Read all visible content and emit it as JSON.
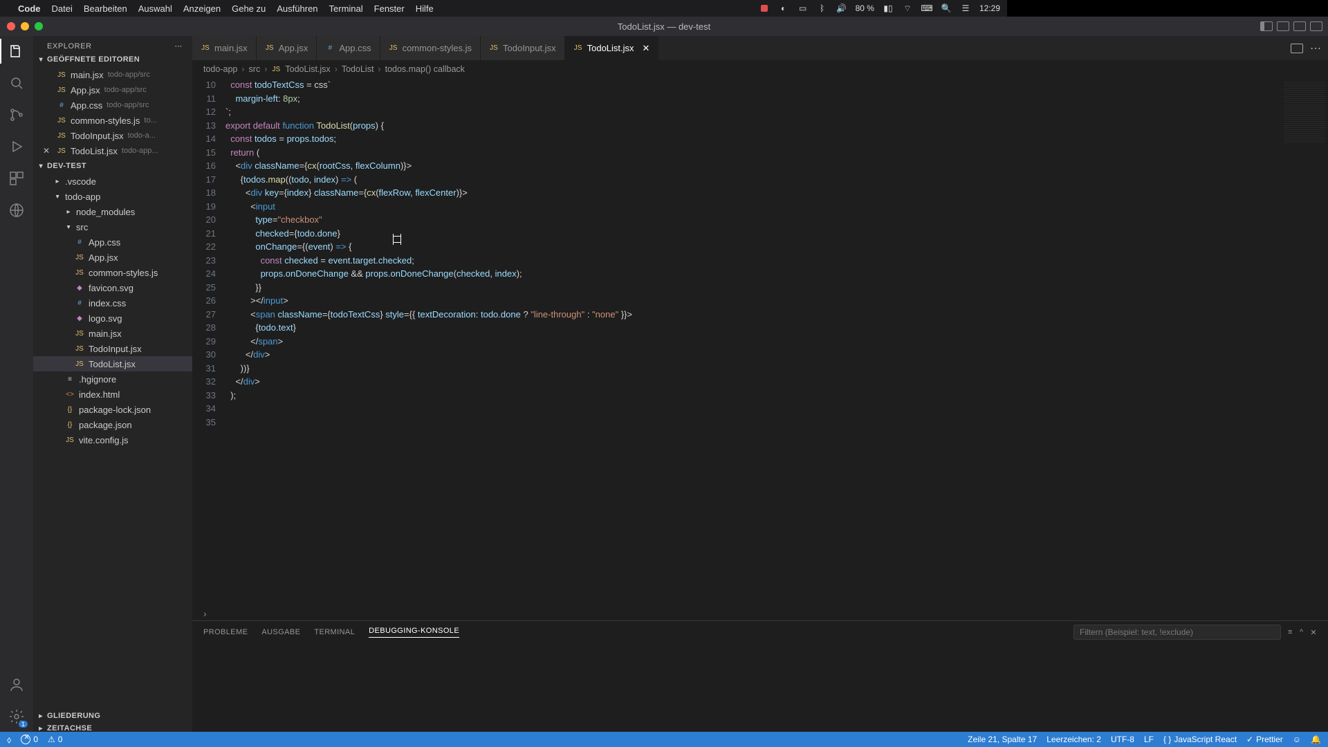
{
  "menubar": {
    "app": "Code",
    "items": [
      "Datei",
      "Bearbeiten",
      "Auswahl",
      "Anzeigen",
      "Gehe zu",
      "Ausführen",
      "Terminal",
      "Fenster",
      "Hilfe"
    ],
    "battery": "80 %",
    "time": "12:29"
  },
  "window": {
    "title": "TodoList.jsx — dev-test"
  },
  "sidebar": {
    "title": "EXPLORER",
    "openEditorsLabel": "GEÖFFNETE EDITOREN",
    "openEditors": [
      {
        "name": "main.jsx",
        "path": "todo-app/src"
      },
      {
        "name": "App.jsx",
        "path": "todo-app/src"
      },
      {
        "name": "App.css",
        "path": "todo-app/src"
      },
      {
        "name": "common-styles.js",
        "path": "to..."
      },
      {
        "name": "TodoInput.jsx",
        "path": "todo-a..."
      },
      {
        "name": "TodoList.jsx",
        "path": "todo-app..."
      }
    ],
    "projectLabel": "DEV-TEST",
    "tree": [
      {
        "kind": "folder",
        "name": ".vscode",
        "indent": 1,
        "open": false
      },
      {
        "kind": "folder",
        "name": "todo-app",
        "indent": 1,
        "open": true
      },
      {
        "kind": "folder",
        "name": "node_modules",
        "indent": 2,
        "open": false
      },
      {
        "kind": "folder",
        "name": "src",
        "indent": 2,
        "open": true
      },
      {
        "kind": "file",
        "name": "App.css",
        "indent": 3,
        "icon": "css"
      },
      {
        "kind": "file",
        "name": "App.jsx",
        "indent": 3,
        "icon": "js"
      },
      {
        "kind": "file",
        "name": "common-styles.js",
        "indent": 3,
        "icon": "js"
      },
      {
        "kind": "file",
        "name": "favicon.svg",
        "indent": 3,
        "icon": "svg"
      },
      {
        "kind": "file",
        "name": "index.css",
        "indent": 3,
        "icon": "css"
      },
      {
        "kind": "file",
        "name": "logo.svg",
        "indent": 3,
        "icon": "svg"
      },
      {
        "kind": "file",
        "name": "main.jsx",
        "indent": 3,
        "icon": "js"
      },
      {
        "kind": "file",
        "name": "TodoInput.jsx",
        "indent": 3,
        "icon": "js"
      },
      {
        "kind": "file",
        "name": "TodoList.jsx",
        "indent": 3,
        "icon": "js",
        "selected": true
      },
      {
        "kind": "file",
        "name": ".hgignore",
        "indent": 2,
        "icon": "txt"
      },
      {
        "kind": "file",
        "name": "index.html",
        "indent": 2,
        "icon": "html"
      },
      {
        "kind": "file",
        "name": "package-lock.json",
        "indent": 2,
        "icon": "json"
      },
      {
        "kind": "file",
        "name": "package.json",
        "indent": 2,
        "icon": "json"
      },
      {
        "kind": "file",
        "name": "vite.config.js",
        "indent": 2,
        "icon": "js"
      }
    ],
    "outlineLabel": "GLIEDERUNG",
    "timelineLabel": "ZEITACHSE"
  },
  "tabs": [
    {
      "name": "main.jsx",
      "icon": "js"
    },
    {
      "name": "App.jsx",
      "icon": "js"
    },
    {
      "name": "App.css",
      "icon": "css"
    },
    {
      "name": "common-styles.js",
      "icon": "js"
    },
    {
      "name": "TodoInput.jsx",
      "icon": "js"
    },
    {
      "name": "TodoList.jsx",
      "icon": "js",
      "active": true
    }
  ],
  "breadcrumb": [
    "todo-app",
    "src",
    "TodoList.jsx",
    "TodoList",
    "todos.map() callback"
  ],
  "code": {
    "startLine": 10,
    "lines": [
      "  const todoTextCss = css`",
      "    margin-left: 8px;",
      "`;",
      "",
      "export default function TodoList(props) {",
      "  const todos = props.todos;",
      "",
      "  return (",
      "    <div className={cx(rootCss, flexColumn)}>",
      "      {todos.map((todo, index) => (",
      "        <div key={index} className={cx(flexRow, flexCenter)}>",
      "          <input",
      "            type=\"checkbox\"",
      "            checked={todo.done}",
      "            onChange={(event) => {",
      "              const checked = event.target.checked;",
      "              props.onDoneChange && props.onDoneChange(checked, index);",
      "            }}",
      "          ></input>",
      "          <span className={todoTextCss} style={{ textDecoration: todo.done ? \"line-through\" : \"none\" }}>",
      "            {todo.text}",
      "          </span>",
      "        </div>",
      "      ))}",
      "    </div>",
      "  );"
    ]
  },
  "panel": {
    "tabs": [
      "PROBLEME",
      "AUSGABE",
      "TERMINAL",
      "DEBUGGING-KONSOLE"
    ],
    "activeTab": 3,
    "filterPlaceholder": "Filtern (Beispiel: text, !exclude)"
  },
  "status": {
    "errors": "0",
    "warnings": "0",
    "cursor": "Zeile 21, Spalte 17",
    "spaces": "Leerzeichen: 2",
    "encoding": "UTF-8",
    "eol": "LF",
    "language": "JavaScript React",
    "prettier": "Prettier"
  }
}
